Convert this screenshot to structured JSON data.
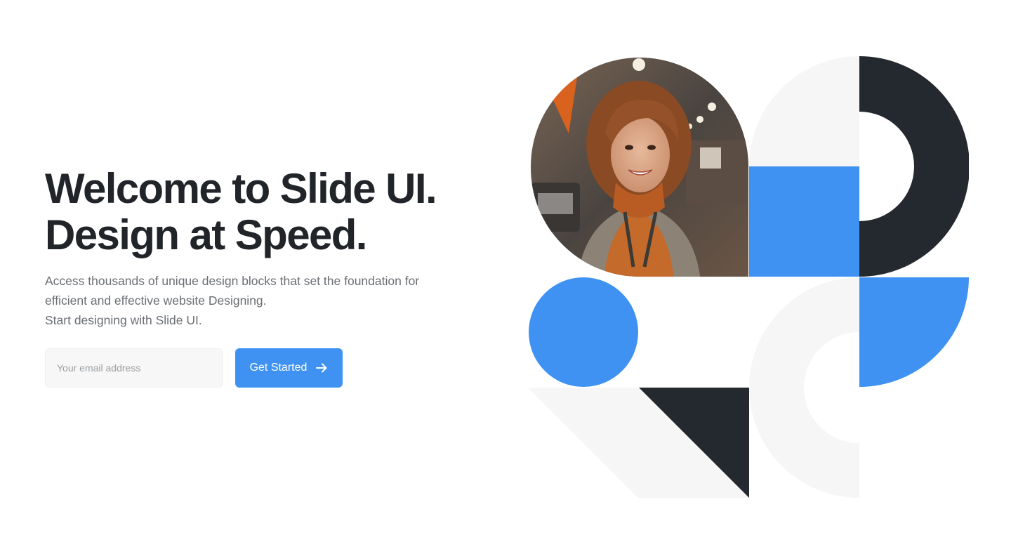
{
  "hero": {
    "headline_line1": "Welcome to Slide UI.",
    "headline_line2": "Design at Speed.",
    "description_line1": "Access thousands of unique design blocks that set the foundation for",
    "description_line2": "efficient and effective website Designing.",
    "description_line3": "Start designing with Slide UI."
  },
  "signup": {
    "email_placeholder": "Your email address",
    "email_value": "",
    "cta_label": "Get Started",
    "cta_icon": "arrow-right-icon"
  },
  "colors": {
    "accent": "#3f92f2",
    "dark": "#23292e",
    "light_gray": "#f6f6f6",
    "text_heading": "#212529",
    "text_body": "#6b6f74"
  }
}
